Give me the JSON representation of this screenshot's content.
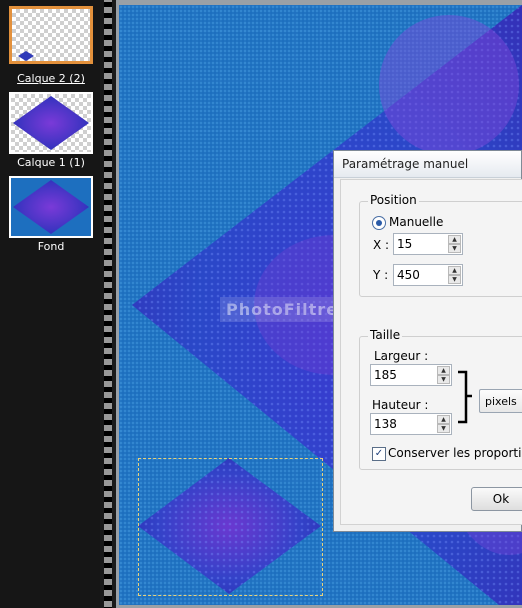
{
  "layers": [
    {
      "name": "Calque 2 (2)",
      "selected": true
    },
    {
      "name": "Calque 1 (1)",
      "selected": false
    },
    {
      "name": "Fond",
      "selected": false
    }
  ],
  "canvas": {
    "watermark": "PhotoFiltreGraphic",
    "background_color": "#1d6fbf"
  },
  "dialog": {
    "title": "Paramétrage manuel",
    "position": {
      "group_label": "Position",
      "mode_label": "Manuelle",
      "x_label": "X :",
      "x_value": "15",
      "y_label": "Y :",
      "y_value": "450"
    },
    "size": {
      "group_label": "Taille",
      "width_label": "Largeur :",
      "width_value": "185",
      "height_label": "Hauteur :",
      "height_value": "138",
      "unit": "pixels",
      "keep_proportions_label": "Conserver les proportions",
      "keep_proportions": true
    },
    "ok_label": "Ok"
  },
  "colors": {
    "selected_border": "#e3913c",
    "diamond": "#3540c8"
  }
}
